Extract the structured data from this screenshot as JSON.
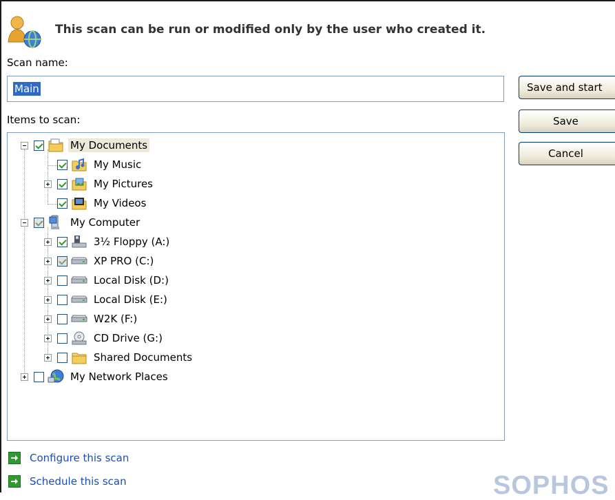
{
  "header": {
    "owner_notice": "This scan can be run or modified only by the user who created it."
  },
  "scan_name": {
    "label": "Scan name:",
    "value": "Main"
  },
  "items": {
    "label": "Items to scan:",
    "tree": [
      {
        "label": "My Documents",
        "checked": "checked",
        "expander": "minus",
        "icon": "documents-folder-icon",
        "selected": true
      },
      {
        "label": "My Music",
        "checked": "checked",
        "expander": "none",
        "icon": "music-folder-icon"
      },
      {
        "label": "My Pictures",
        "checked": "checked",
        "expander": "plus",
        "icon": "pictures-folder-icon"
      },
      {
        "label": "My Videos",
        "checked": "checked",
        "expander": "none",
        "icon": "videos-folder-icon"
      },
      {
        "label": "My Computer",
        "checked": "partial",
        "expander": "minus",
        "icon": "computer-icon"
      },
      {
        "label": "3½ Floppy (A:)",
        "checked": "checked",
        "expander": "plus",
        "icon": "floppy-drive-icon"
      },
      {
        "label": "XP PRO (C:)",
        "checked": "partial",
        "expander": "plus",
        "icon": "hard-disk-icon"
      },
      {
        "label": "Local Disk (D:)",
        "checked": "unchecked",
        "expander": "plus",
        "icon": "hard-disk-icon"
      },
      {
        "label": "Local Disk (E:)",
        "checked": "unchecked",
        "expander": "plus",
        "icon": "hard-disk-icon"
      },
      {
        "label": "W2K (F:)",
        "checked": "unchecked",
        "expander": "plus",
        "icon": "hard-disk-icon"
      },
      {
        "label": "CD Drive (G:)",
        "checked": "unchecked",
        "expander": "plus",
        "icon": "cd-drive-icon"
      },
      {
        "label": "Shared Documents",
        "checked": "unchecked",
        "expander": "plus",
        "icon": "shared-folder-icon"
      },
      {
        "label": "My Network Places",
        "checked": "unchecked",
        "expander": "plus",
        "icon": "network-places-icon"
      }
    ]
  },
  "buttons": {
    "save_and_start": "Save and start",
    "save": "Save",
    "cancel": "Cancel"
  },
  "links": {
    "configure": "Configure this scan",
    "schedule": "Schedule this scan"
  },
  "brand": "SOPHOS",
  "colors": {
    "selection": "#316ac5",
    "link": "#1b4eb4",
    "checkmark": "#21a121",
    "brand_watermark": "#b8c7dd"
  }
}
